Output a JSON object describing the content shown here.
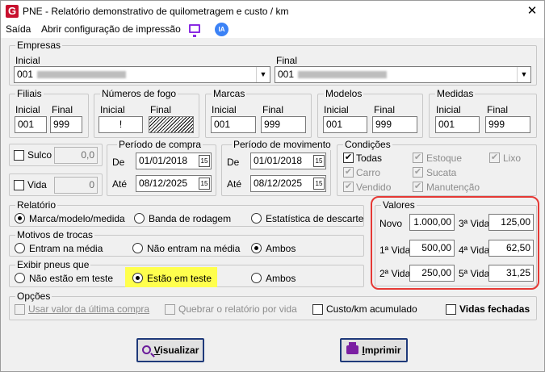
{
  "window": {
    "title": "PNE - Relatório demonstrativo de quilometragem e custo / km",
    "app_icon": "G",
    "close": "✕"
  },
  "menu": {
    "items": [
      "Saída",
      "Abrir configuração de impressão"
    ],
    "ia_label": "IA"
  },
  "empresas": {
    "title": "Empresas",
    "inicial_label": "Inicial",
    "inicial_value": "001",
    "final_label": "Final",
    "final_value": "001"
  },
  "filiais": {
    "title": "Filiais",
    "inicial_label": "Inicial",
    "inicial_value": "001",
    "final_label": "Final",
    "final_value": "999"
  },
  "numeros_fogo": {
    "title": "Números de fogo",
    "inicial_label": "Inicial",
    "inicial_value": "!",
    "final_label": "Final"
  },
  "marcas": {
    "title": "Marcas",
    "inicial_label": "Inicial",
    "inicial_value": "001",
    "final_label": "Final",
    "final_value": "999"
  },
  "modelos": {
    "title": "Modelos",
    "inicial_label": "Inicial",
    "inicial_value": "001",
    "final_label": "Final",
    "final_value": "999"
  },
  "medidas": {
    "title": "Medidas",
    "inicial_label": "Inicial",
    "inicial_value": "001",
    "final_label": "Final",
    "final_value": "999"
  },
  "sulco": {
    "label": "Sulco",
    "value": "0,0"
  },
  "vida": {
    "label": "Vida",
    "value": "0"
  },
  "periodo_compra": {
    "title": "Período de compra",
    "de_label": "De",
    "de_value": "01/01/2018",
    "ate_label": "Até",
    "ate_value": "08/12/2025"
  },
  "periodo_movimento": {
    "title": "Período de movimento",
    "de_label": "De",
    "de_value": "01/01/2018",
    "ate_label": "Até",
    "ate_value": "08/12/2025"
  },
  "calendar_icon_text": "15",
  "condicoes": {
    "title": "Condições",
    "items": [
      {
        "label": "Todas",
        "checked": true,
        "enabled": true
      },
      {
        "label": "Estoque",
        "checked": true,
        "enabled": false
      },
      {
        "label": "Lixo",
        "checked": true,
        "enabled": false
      },
      {
        "label": "Carro",
        "checked": true,
        "enabled": false
      },
      {
        "label": "Sucata",
        "checked": true,
        "enabled": false
      },
      {
        "label": "Vendido",
        "checked": true,
        "enabled": false
      },
      {
        "label": "Manutenção",
        "checked": true,
        "enabled": false
      }
    ]
  },
  "relatorio": {
    "title": "Relatório",
    "options": [
      "Marca/modelo/medida",
      "Banda de rodagem",
      "Estatística de descarte"
    ],
    "selected": 0
  },
  "motivos_trocas": {
    "title": "Motivos de trocas",
    "options": [
      "Entram na média",
      "Não entram na média",
      "Ambos"
    ],
    "selected": 2
  },
  "exibir_pneus": {
    "title": "Exibir pneus que",
    "options": [
      "Não estão em teste",
      "Estão em teste",
      "Ambos"
    ],
    "selected": 1
  },
  "valores": {
    "title": "Valores",
    "novo_label": "Novo",
    "novo_value": "1.000,00",
    "vida1_label": "1ª Vida",
    "vida1_value": "500,00",
    "vida2_label": "2ª Vida",
    "vida2_value": "250,00",
    "vida3_label": "3ª Vida",
    "vida3_value": "125,00",
    "vida4_label": "4ª Vida",
    "vida4_value": "62,50",
    "vida5_label": "5ª Vida",
    "vida5_value": "31,25"
  },
  "opcoes": {
    "title": "Opções",
    "usar_valor": "Usar valor da última compra",
    "quebrar": "Quebrar o relatório por vida",
    "custo_km": "Custo/km acumulado",
    "vidas_fechadas": "Vidas fechadas"
  },
  "buttons": {
    "visualizar_first": "V",
    "visualizar_rest": "isualizar",
    "imprimir_first": "I",
    "imprimir_rest": "mprimir"
  },
  "colors": {
    "highlight": "#ffff4d",
    "outline": "#e53935",
    "brand": "#c8102e",
    "button_border": "#1f3a7a",
    "icon_purple": "#7b1fa2"
  },
  "icons": {
    "app": "g-logo-icon",
    "monitor": "monitor-icon",
    "ia": "ia-icon",
    "calendar": "calendar-icon",
    "search": "search-icon",
    "print": "printer-icon"
  }
}
